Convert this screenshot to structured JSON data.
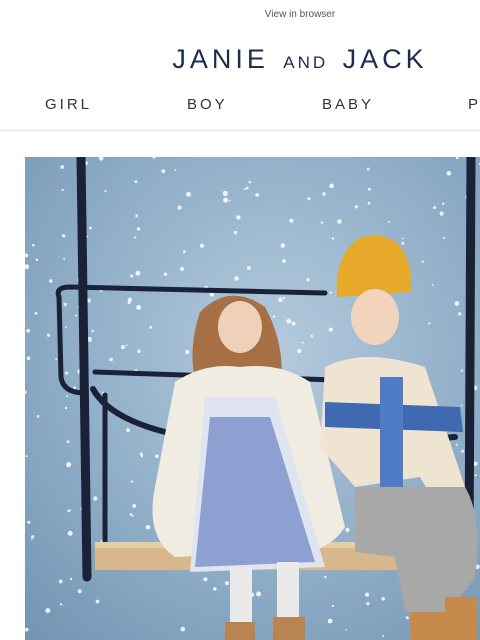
{
  "header": {
    "view_in_browser": "View in browser",
    "logo": {
      "part1": "JANIE",
      "part2": "AND",
      "part3": "JACK"
    }
  },
  "nav": {
    "items": [
      {
        "label": "GIRL"
      },
      {
        "label": "BOY"
      },
      {
        "label": "BABY"
      },
      {
        "label": "P"
      }
    ]
  },
  "hero": {
    "image": "kids-on-ski-lift-photo"
  },
  "colors": {
    "logo": "#1d2b4f",
    "nav_text": "#333333",
    "hero_bg": "#8eaec8",
    "lift_frame": "#1b2237"
  }
}
